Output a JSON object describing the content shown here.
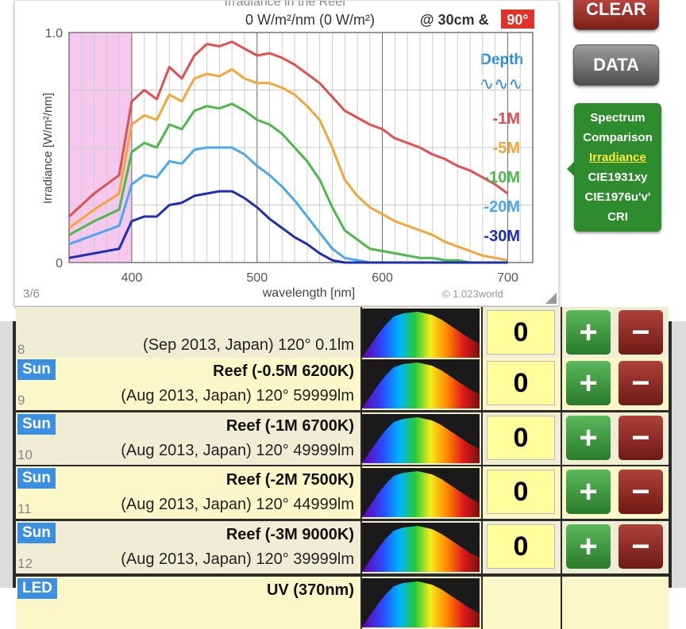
{
  "chart": {
    "title": "Irradiance in the Reef",
    "power_readout": "0 W/m²/nm   (0 W/m²)",
    "distance_label": "@ 30cm &",
    "angle_badge": "90°",
    "ylabel": "Irradiance [W/m²/nm]",
    "xlabel": "wavelength [nm]",
    "page_indicator": "3/6",
    "copyright": "© 1.023world",
    "depth_title": "Depth",
    "wave_glyph": "∿∿∿",
    "uv_band_color": "#f6c8ef"
  },
  "chart_data": {
    "type": "line",
    "xlabel": "wavelength [nm]",
    "ylabel": "Irradiance [W/m²/nm]",
    "xlim": [
      350,
      720
    ],
    "ylim": [
      0,
      1.0
    ],
    "xticks": [
      "400",
      "500",
      "600",
      "700"
    ],
    "yticks": [
      "0",
      "1.0"
    ],
    "grid": true,
    "legend_position": "right",
    "x": [
      350,
      370,
      390,
      400,
      410,
      420,
      430,
      440,
      450,
      460,
      470,
      480,
      490,
      500,
      510,
      520,
      530,
      540,
      550,
      560,
      570,
      580,
      590,
      600,
      610,
      620,
      630,
      640,
      650,
      660,
      670,
      680,
      690,
      700
    ],
    "series": [
      {
        "name": "-1M",
        "color": "#e05050",
        "values": [
          0.2,
          0.3,
          0.38,
          0.7,
          0.75,
          0.71,
          0.85,
          0.8,
          0.9,
          0.95,
          0.94,
          0.96,
          0.93,
          0.9,
          0.91,
          0.89,
          0.86,
          0.82,
          0.78,
          0.72,
          0.66,
          0.63,
          0.6,
          0.58,
          0.54,
          0.52,
          0.5,
          0.47,
          0.45,
          0.42,
          0.4,
          0.37,
          0.34,
          0.3
        ]
      },
      {
        "name": "-5M",
        "color": "#f5a63a",
        "values": [
          0.15,
          0.23,
          0.3,
          0.6,
          0.64,
          0.62,
          0.73,
          0.7,
          0.8,
          0.82,
          0.81,
          0.84,
          0.8,
          0.78,
          0.78,
          0.76,
          0.73,
          0.68,
          0.62,
          0.5,
          0.36,
          0.29,
          0.24,
          0.21,
          0.18,
          0.16,
          0.14,
          0.12,
          0.09,
          0.07,
          0.05,
          0.03,
          0.02,
          0.01
        ]
      },
      {
        "name": "-10M",
        "color": "#4cb94c",
        "values": [
          0.12,
          0.18,
          0.23,
          0.48,
          0.52,
          0.5,
          0.6,
          0.58,
          0.66,
          0.68,
          0.67,
          0.69,
          0.66,
          0.62,
          0.6,
          0.56,
          0.5,
          0.44,
          0.36,
          0.24,
          0.14,
          0.1,
          0.06,
          0.05,
          0.04,
          0.03,
          0.02,
          0.02,
          0.01,
          0.01,
          0.0,
          0.0,
          0.0,
          0.0
        ]
      },
      {
        "name": "-20M",
        "color": "#4aa8ee",
        "values": [
          0.08,
          0.12,
          0.16,
          0.34,
          0.38,
          0.37,
          0.44,
          0.43,
          0.49,
          0.5,
          0.5,
          0.5,
          0.47,
          0.42,
          0.38,
          0.33,
          0.27,
          0.2,
          0.13,
          0.06,
          0.02,
          0.01,
          0.0,
          0.0,
          0.0,
          0.0,
          0.0,
          0.0,
          0.0,
          0.0,
          0.0,
          0.0,
          0.0,
          0.0
        ]
      },
      {
        "name": "-30M",
        "color": "#1f2fb3",
        "values": [
          0.02,
          0.04,
          0.06,
          0.18,
          0.2,
          0.2,
          0.25,
          0.26,
          0.29,
          0.3,
          0.31,
          0.31,
          0.28,
          0.24,
          0.19,
          0.15,
          0.11,
          0.08,
          0.04,
          0.01,
          0.0,
          0.0,
          0.0,
          0.0,
          0.0,
          0.0,
          0.0,
          0.0,
          0.0,
          0.0,
          0.0,
          0.0,
          0.0,
          0.0
        ]
      }
    ]
  },
  "buttons": {
    "clear": "CLEAR",
    "data": "DATA"
  },
  "menu": {
    "items": [
      "Spectrum",
      "Comparison",
      "Irradiance",
      "CIE1931xy",
      "CIE1976u'v'",
      "CRI"
    ],
    "active_index": 2
  },
  "rows": [
    {
      "type": "",
      "index": "8",
      "name": "",
      "desc": "(Sep 2013, Japan) 120° 0.1lm",
      "qty": "0",
      "plus": "+",
      "minus": "−"
    },
    {
      "type": "Sun",
      "index": "9",
      "name": "Reef (-0.5M 6200K)",
      "desc": "(Aug 2013, Japan) 120° 59999lm",
      "qty": "0",
      "plus": "+",
      "minus": "−"
    },
    {
      "type": "Sun",
      "index": "10",
      "name": "Reef (-1M 6700K)",
      "desc": "(Aug 2013, Japan) 120° 49999lm",
      "qty": "0",
      "plus": "+",
      "minus": "−"
    },
    {
      "type": "Sun",
      "index": "11",
      "name": "Reef (-2M 7500K)",
      "desc": "(Aug 2013, Japan) 120° 44999lm",
      "qty": "0",
      "plus": "+",
      "minus": "−"
    },
    {
      "type": "Sun",
      "index": "12",
      "name": "Reef (-3M 9000K)",
      "desc": "(Aug 2013, Japan) 120° 39999lm",
      "qty": "0",
      "plus": "+",
      "minus": "−"
    },
    {
      "type": "LED",
      "index": "",
      "name": "UV (370nm)",
      "desc": "",
      "qty": "",
      "plus": "",
      "minus": ""
    }
  ]
}
